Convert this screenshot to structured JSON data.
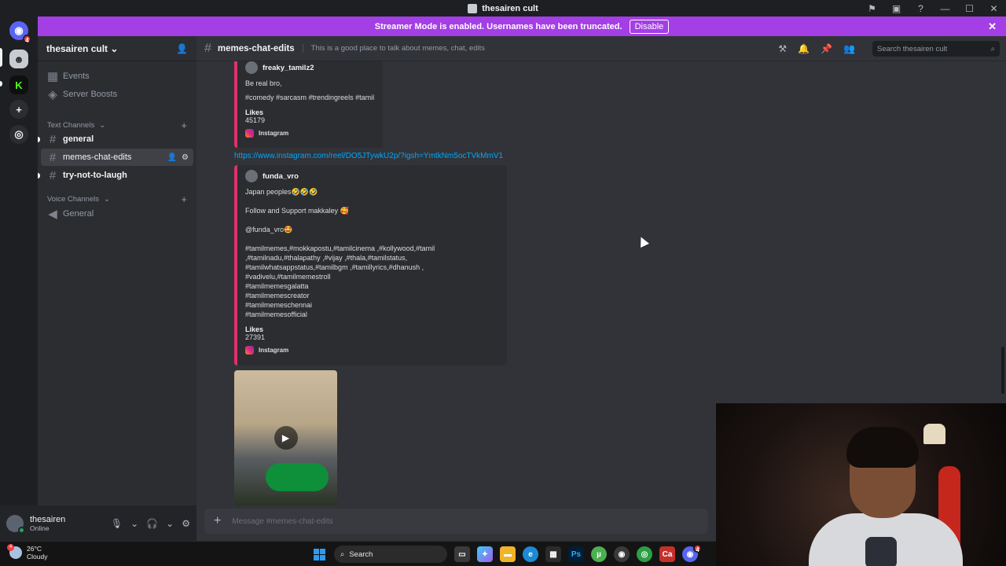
{
  "window": {
    "title": "thesairen cult"
  },
  "servers": {
    "home_badge": "4"
  },
  "banner": {
    "text": "Streamer Mode is enabled. Usernames have been truncated.",
    "disable_label": "Disable"
  },
  "sidebar": {
    "server_name": "thesairen cult",
    "events_label": "Events",
    "boosts_label": "Server Boosts",
    "text_category": "Text Channels",
    "text_channels": [
      "general",
      "memes-chat-edits",
      "try-not-to-laugh"
    ],
    "voice_category": "Voice Channels",
    "voice_channels": [
      "General"
    ]
  },
  "user": {
    "name": "thesairen",
    "status": "Online"
  },
  "channel": {
    "name": "memes-chat-edits",
    "topic": "This is a good place to talk about memes, chat, edits"
  },
  "search": {
    "placeholder": "Search thesairen cult"
  },
  "messages": {
    "embed1": {
      "author": "freaky_tamilz2",
      "desc1": "Be real bro,",
      "desc2": "#comedy #sarcasm #trendingreels #tamil",
      "likes_label": "Likes",
      "likes": "45179",
      "footer": "Instagram"
    },
    "link": "https://www.instagram.com/reel/DO5JTywkU2p/?igsh=YmtkNm5ocTVkMmV1",
    "embed2": {
      "author": "funda_vro",
      "line1": "Japan peoples🤣🤣🤣",
      "line2": "Follow and Support makkaley 🥰",
      "line3": "@funda_vro🤩",
      "tags": "#tamilmemes,#mokkapostu,#tamilcinema ,#kollywood,#tamil ,#tamilnadu,#thalapathy ,#vijay ,#thala,#tamilstatus, #tamilwhatsappstatus,#tamilbgm ,#tamillyrics,#dhanush , #vadivelu,#tamilmemestroll",
      "tag2": "#tamilmemesgalatta",
      "tag3": "#tamilmemescreator",
      "tag4": "#tamilmemeschennai",
      "tag5": "#tamilmemesofficial",
      "likes_label": "Likes",
      "likes": "27391",
      "footer": "Instagram"
    }
  },
  "composer": {
    "placeholder": "Message #memes-chat-edits"
  },
  "taskbar": {
    "temp": "26°C",
    "weather": "Cloudy",
    "weather_badge": "4",
    "search_label": "Search",
    "discord_badge": "4"
  }
}
